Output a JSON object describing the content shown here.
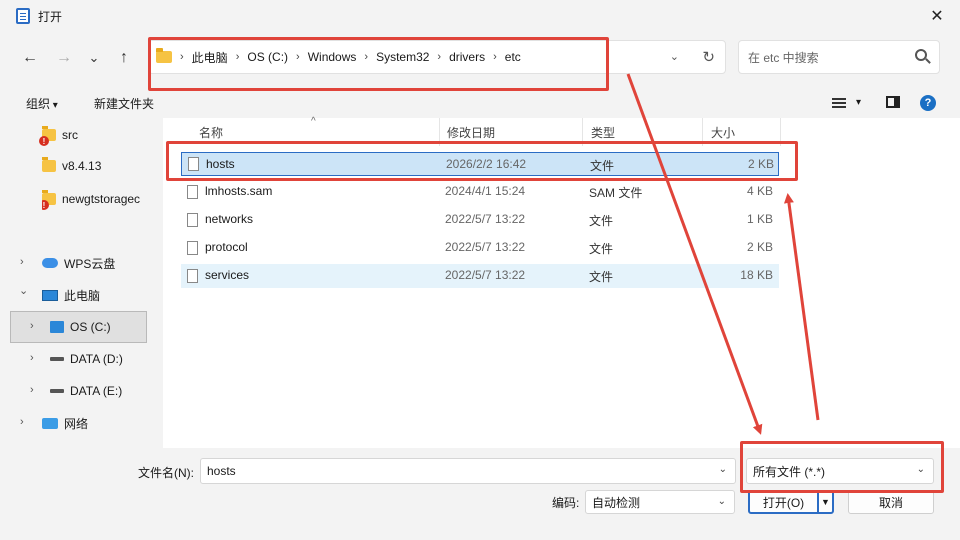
{
  "window": {
    "title": "打开",
    "close_glyph": "✕"
  },
  "nav": {
    "back": "←",
    "forward": "→",
    "recent": "⌄",
    "up": "↑"
  },
  "address": {
    "crumbs": [
      "此电脑",
      "OS (C:)",
      "Windows",
      "System32",
      "drivers",
      "etc"
    ],
    "separator": "›",
    "dropdown_glyph": "⌄",
    "refresh_glyph": "↻"
  },
  "search": {
    "placeholder": "在 etc 中搜索"
  },
  "toolbar": {
    "organize": "组织",
    "new_folder": "新建文件夹",
    "help": "?"
  },
  "sidebar": {
    "items": [
      {
        "label": "src",
        "icon": "folder-warning-icon"
      },
      {
        "label": "v8.4.13",
        "icon": "folder-icon"
      },
      {
        "label": "newgtstoragec",
        "icon": "folder-warning-icon"
      },
      {
        "label": "WPS云盘",
        "icon": "cloud-icon"
      },
      {
        "label": "此电脑",
        "icon": "computer-icon"
      },
      {
        "label": "OS (C:)",
        "icon": "windows-drive-icon"
      },
      {
        "label": "DATA (D:)",
        "icon": "drive-icon"
      },
      {
        "label": "DATA (E:)",
        "icon": "drive-icon"
      },
      {
        "label": "网络",
        "icon": "network-icon"
      }
    ],
    "chevron_right": "›",
    "chevron_down": "⌄"
  },
  "columns": {
    "name": "名称",
    "modified": "修改日期",
    "type": "类型",
    "size": "大小",
    "sort_glyph": "^"
  },
  "files": [
    {
      "name": "hosts",
      "modified": "2026/2/2 16:42",
      "type": "文件",
      "size": "2 KB"
    },
    {
      "name": "lmhosts.sam",
      "modified": "2024/4/1 15:24",
      "type": "SAM 文件",
      "size": "4 KB"
    },
    {
      "name": "networks",
      "modified": "2022/5/7 13:22",
      "type": "文件",
      "size": "1 KB"
    },
    {
      "name": "protocol",
      "modified": "2022/5/7 13:22",
      "type": "文件",
      "size": "2 KB"
    },
    {
      "name": "services",
      "modified": "2022/5/7 13:22",
      "type": "文件",
      "size": "18 KB"
    }
  ],
  "bottom": {
    "filename_label": "文件名(N):",
    "filename_value": "hosts",
    "filter_value": "所有文件 (*.*)",
    "encoding_label": "编码:",
    "encoding_value": "自动检测",
    "open_button": "打开(O)",
    "cancel_button": "取消",
    "dd_glyph": "⌄",
    "split_glyph": "▼"
  },
  "colors": {
    "annotation": "#e0443a",
    "selection": "#cce4f7",
    "accent": "#2b6cc4"
  }
}
